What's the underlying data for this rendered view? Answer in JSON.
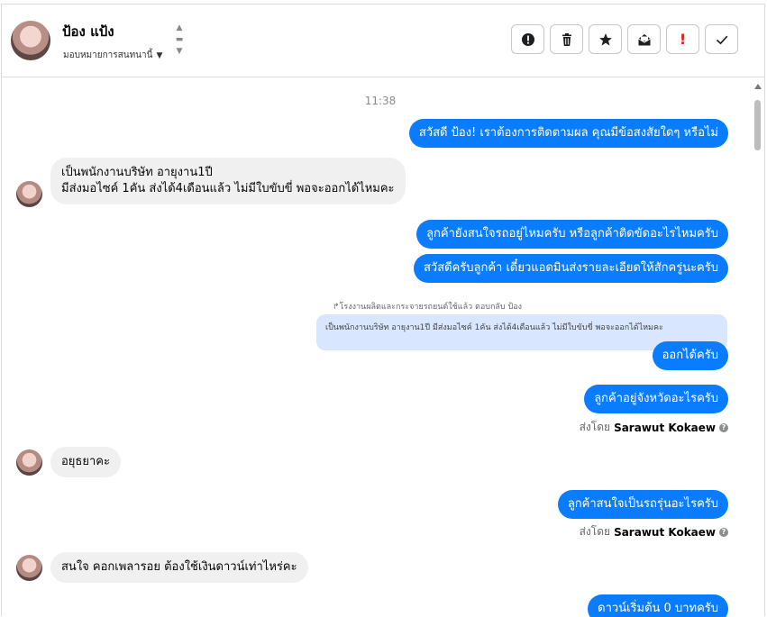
{
  "contact": {
    "name": "ป้อง แป้ง",
    "assign_label": "มอบหมายการสนทนานี้"
  },
  "toolbar": {
    "buttons": [
      "alert-icon",
      "trash-icon",
      "star-icon",
      "mail-open-icon",
      "exclamation-icon",
      "check-icon"
    ],
    "exclamation_text": "!",
    "accent_red": "#e02020"
  },
  "colors": {
    "outgoing_bubble": "#0a7cff",
    "incoming_bubble": "#f0f0f0",
    "quoted_bg": "#d8e6ff"
  },
  "thread": {
    "timestamp": "11:38",
    "m1": "สวัสดี ป้อง! เราต้องการติดตามผล คุณมีข้อสงสัยใดๆ หรือไม่",
    "m2_line1": "เป็นพนักงานบริษัท อายุงาน1ปี",
    "m2_line2": "มีส่งมอไซค์ 1คัน ส่งได้4เดือนแล้ว ไม่มีใบขับขี่ พอจะออกได้ไหมคะ",
    "m3": "ลูกค้ายังสนใจรถอยู่ไหมครับ หรือลูกค้าติดขัดอะไรไหมครับ",
    "m4": "สวัสดีครับลูกค้า เดี๋ยวแอดมินส่งรายละเอียดให้สักครู่นะครับ",
    "reply_label": "โรงงานผลิตและกระจายรถยนต์ใช้แล้ว ตอบกลับ ป้อง",
    "quoted_text": "เป็นพนักงานบริษัท อายุงาน1ปี มีส่งมอไซค์ 1คัน ส่งได้4เดือนแล้ว ไม่มีใบขับขี่ พอจะออกได้ไหมคะ",
    "m5": "ออกได้ครับ",
    "m6": "ลูกค้าอยู่จังหวัดอะไรครับ",
    "sent_by_prefix": "ส่งโดย",
    "sent_by_name": "Sarawut Kokaew",
    "m7": "อยุธยาคะ",
    "m8": "ลูกค้าสนใจเป็นรถรุ่นอะไรครับ",
    "m9": "สนใจ คอกเพลารอย ต้องใช้เงินดาวน์เท่าไหร่คะ",
    "m10": "ดาวน์เริ่มต้น 0 บาทครับ"
  }
}
